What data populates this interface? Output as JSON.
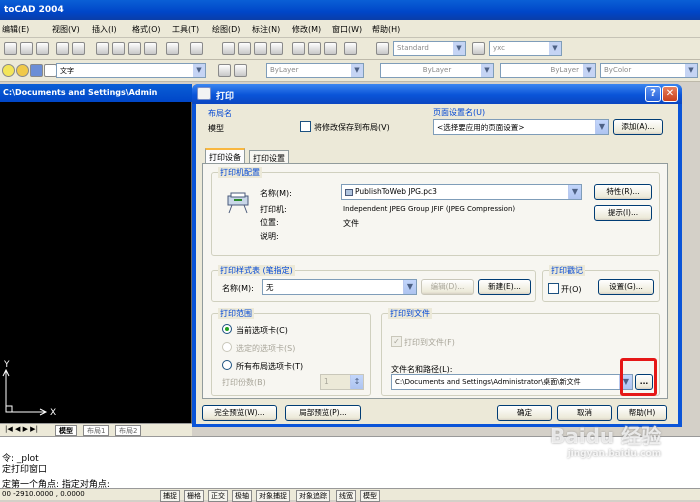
{
  "app": {
    "title": "toCAD 2004"
  },
  "menu": [
    "编辑(E)",
    "视图(V)",
    "插入(I)",
    "格式(O)",
    "工具(T)",
    "绘图(D)",
    "标注(N)",
    "修改(M)",
    "窗口(W)",
    "帮助(H)"
  ],
  "toolbar2": {
    "text_style": "Standard",
    "dim_style": "yxc"
  },
  "toolbar3": {
    "layer": "文字",
    "color": "ByLayer",
    "linetype": "ByLayer",
    "lineweight": "ByLayer",
    "plotstyle": "ByColor"
  },
  "drawing": {
    "title": "C:\\Documents and Settings\\Admin",
    "axis_y": "Y",
    "axis_x": "X",
    "tabs": [
      "模型",
      "布局1",
      "布局2"
    ]
  },
  "command": {
    "line1": "令: _plot",
    "line2": "定打印窗口",
    "line3": "定第一个角点: 指定对角点:"
  },
  "status": {
    "coords": "00  -2910.0000 , 0.0000",
    "toggles": [
      "捕捉",
      "栅格",
      "正交",
      "极轴",
      "对象捕捉",
      "对象追踪",
      "线宽",
      "模型"
    ]
  },
  "dialog": {
    "title": "打印",
    "layout_group": "布局名",
    "layout_name": "模型",
    "save_to_layout": "将修改保存到布局(V)",
    "pagesetup_group": "页面设置名(U)",
    "pagesetup_value": "<选择要应用的页面设置>",
    "add_button": "添加(A)...",
    "tab_device": "打印设备",
    "tab_settings": "打印设置",
    "printer_group": "打印机配置",
    "name_label": "名称(M):",
    "printer_name": "PublishToWeb JPG.pc3",
    "properties_button": "特性(R)...",
    "printer_label": "打印机:",
    "printer_value": "Independent JPEG Group JFIF (JPEG Compression)",
    "location_label": "位置:",
    "location_value": "文件",
    "desc_label": "说明:",
    "hints_button": "提示(I)...",
    "style_group": "打印样式表 (笔指定)",
    "style_name_label": "名称(M):",
    "style_value": "无",
    "edit_button": "编辑(D)...",
    "new_button": "新建(E)...",
    "stamp_group": "打印戳记",
    "stamp_on": "开(O)",
    "stamp_settings_button": "设置(G)...",
    "range_group": "打印范围",
    "range_current": "当前选项卡(C)",
    "range_selected": "选定的选项卡(S)",
    "range_all": "所有布局选项卡(T)",
    "copies_label": "打印份数(B)",
    "copies_value": "1",
    "tofile_group": "打印到文件",
    "tofile_check": "打印到文件(F)",
    "filepath_label": "文件名和路径(L):",
    "filepath_value": "C:\\Documents and Settings\\Administrator\\桌面\\新文件",
    "browse_button": "...",
    "full_preview": "完全预览(W)...",
    "partial_preview": "局部预览(P)...",
    "ok": "确定",
    "cancel": "取消",
    "help": "帮助(H)"
  },
  "watermark": {
    "text": "Baidu 经验",
    "url": "jingyan.baidu.com"
  }
}
